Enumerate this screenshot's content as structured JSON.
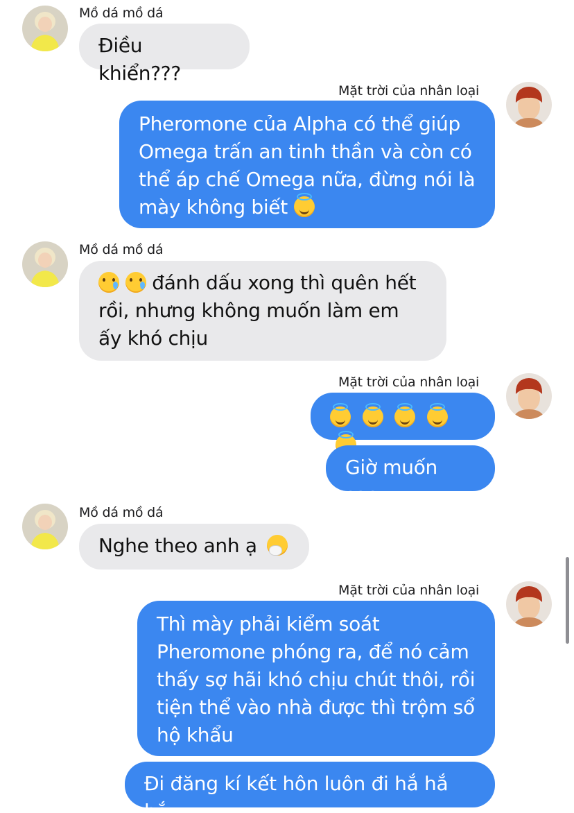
{
  "participants": {
    "friend": {
      "name": "Mồ dá mồ dá"
    },
    "me": {
      "name": "Mặt trời của nhân loại"
    }
  },
  "messages": [
    {
      "sender": "friend",
      "text": "Điều khiển???"
    },
    {
      "sender": "me",
      "text": "Pheromone của Alpha có thể giúp Omega trấn an tinh thần và còn có thể áp chế Omega nữa, đừng nói là mày không biết",
      "emoji": [
        "smiling-face-with-halo"
      ]
    },
    {
      "sender": "friend",
      "emoji_lead": [
        "crying-face",
        "crying-face"
      ],
      "text": "đánh dấu xong thì quên hết rồi, nhưng không muốn làm em ấy khó chịu"
    },
    {
      "sender": "me",
      "emoji": [
        "smiling-face-with-halo",
        "smiling-face-with-halo",
        "smiling-face-with-halo",
        "smiling-face-with-halo",
        "smiling-face-with-halo"
      ]
    },
    {
      "sender": "me",
      "text": "Giờ muốn sao"
    },
    {
      "sender": "friend",
      "text": "Nghe theo anh ạ",
      "emoji": [
        "sneezing-face"
      ]
    },
    {
      "sender": "me",
      "text": "Thì mày phải kiểm soát Pheromone phóng ra, để nó cảm thấy sợ hãi khó chịu chút thôi, rồi tiện thể vào nhà được thì trộm sổ hộ khẩu"
    },
    {
      "sender": "me",
      "text": "Đi đăng kí kết hôn luôn đi hắ hắ hắ"
    }
  ],
  "colors": {
    "outgoing_bubble": "#3b87f0",
    "incoming_bubble": "#e9e9eb",
    "outgoing_text": "#ffffff",
    "incoming_text": "#111111"
  }
}
